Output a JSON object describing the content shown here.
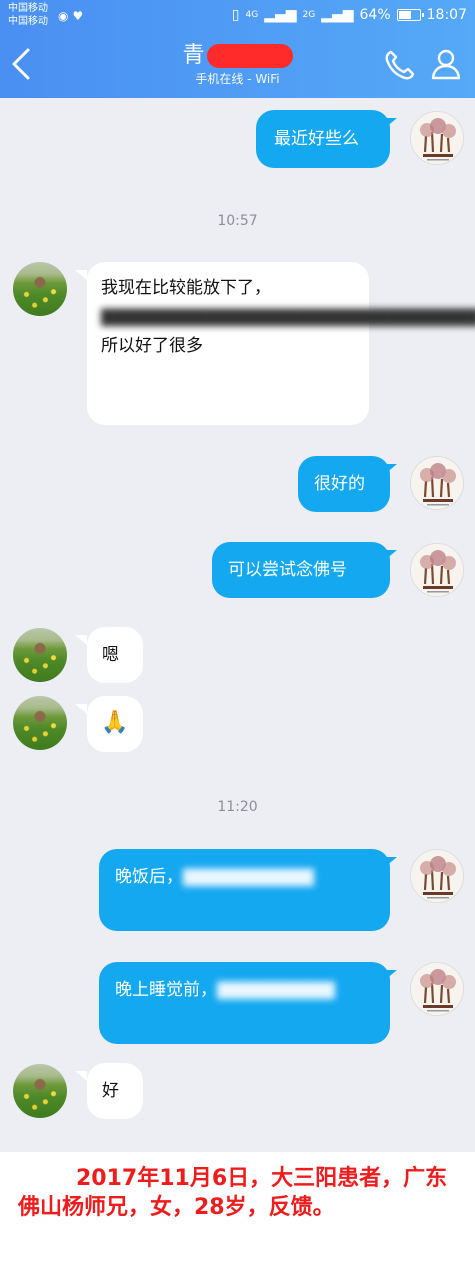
{
  "status_bar": {
    "carrier_1": "中国移动",
    "carrier_2": "中国移动",
    "network_1": "4G",
    "network_2": "2G",
    "battery_percent": "64%",
    "battery_level": 0.64,
    "time": "18:07"
  },
  "header": {
    "contact_name": "青",
    "contact_status": "手机在线 - WiFi"
  },
  "messages": {
    "m1": {
      "text": "最近好些么"
    },
    "ts1": "10:57",
    "m2": {
      "visible_1": "我现在比较能放下了，",
      "blurred": "▇▇▇▇▇▇▇▇▇▇▇▇▇▇▇▇▇▇▇▇▇▇▇▇▇▇▇▇▇",
      "visible_2": "，所以好了很多"
    },
    "m3": {
      "text": "很好的"
    },
    "m4": {
      "text": "可以尝试念佛号"
    },
    "m5": {
      "text": "嗯"
    },
    "m6": {
      "text": "🙏"
    },
    "ts2": "11:20",
    "m7": {
      "visible": "晚饭后，",
      "blurred": "▇▇▇▇▇▇▇▇▇▇"
    },
    "m8": {
      "visible": "晚上睡觉前，",
      "blurred": "▇▇▇▇▇▇▇▇▇"
    },
    "m9": {
      "text": "好"
    }
  },
  "footer": {
    "caption": "2017年11月6日，大三阳患者，广东佛山杨师兄，女，28岁，反馈。"
  },
  "colors": {
    "header_start": "#4a8ff2",
    "header_end": "#55a9f7",
    "my_bubble": "#14a8f0",
    "friend_bubble": "#ffffff",
    "chat_background": "#eceef3",
    "caption_text": "#ee1c1c"
  }
}
